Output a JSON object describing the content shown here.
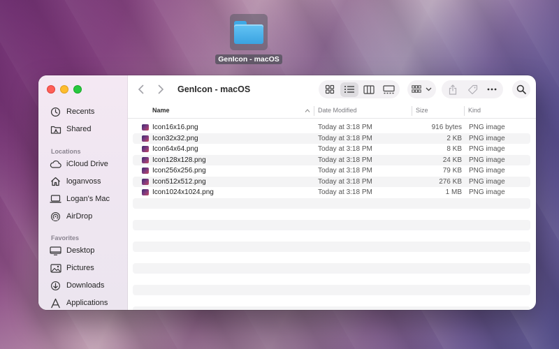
{
  "desktop": {
    "icon_label": "GenIcon - macOS"
  },
  "window": {
    "title": "GenIcon - macOS"
  },
  "sidebar": {
    "top_items": [
      {
        "label": "Recents",
        "icon": "clock-icon"
      },
      {
        "label": "Shared",
        "icon": "shared-folder-icon"
      }
    ],
    "locations_heading": "Locations",
    "locations": [
      {
        "label": "iCloud Drive",
        "icon": "cloud-icon"
      },
      {
        "label": "loganvoss",
        "icon": "home-icon"
      },
      {
        "label": "Logan's Mac",
        "icon": "laptop-icon"
      },
      {
        "label": "AirDrop",
        "icon": "airdrop-icon"
      }
    ],
    "favorites_heading": "Favorites",
    "favorites": [
      {
        "label": "Desktop",
        "icon": "desktop-icon"
      },
      {
        "label": "Pictures",
        "icon": "pictures-icon"
      },
      {
        "label": "Downloads",
        "icon": "downloads-icon"
      },
      {
        "label": "Applications",
        "icon": "applications-icon"
      }
    ]
  },
  "columns": {
    "name": "Name",
    "date": "Date Modified",
    "size": "Size",
    "kind": "Kind"
  },
  "files": [
    {
      "name": "Icon16x16.png",
      "date": "Today at 3:18 PM",
      "size": "916 bytes",
      "kind": "PNG image"
    },
    {
      "name": "Icon32x32.png",
      "date": "Today at 3:18 PM",
      "size": "2 KB",
      "kind": "PNG image"
    },
    {
      "name": "Icon64x64.png",
      "date": "Today at 3:18 PM",
      "size": "8 KB",
      "kind": "PNG image"
    },
    {
      "name": "Icon128x128.png",
      "date": "Today at 3:18 PM",
      "size": "24 KB",
      "kind": "PNG image"
    },
    {
      "name": "Icon256x256.png",
      "date": "Today at 3:18 PM",
      "size": "79 KB",
      "kind": "PNG image"
    },
    {
      "name": "Icon512x512.png",
      "date": "Today at 3:18 PM",
      "size": "276 KB",
      "kind": "PNG image"
    },
    {
      "name": "Icon1024x1024.png",
      "date": "Today at 3:18 PM",
      "size": "1 MB",
      "kind": "PNG image"
    }
  ],
  "colors": {
    "folder": "#3fa9e6",
    "close": "#fe5f57",
    "minimize": "#febc2e",
    "zoom": "#28c840"
  }
}
